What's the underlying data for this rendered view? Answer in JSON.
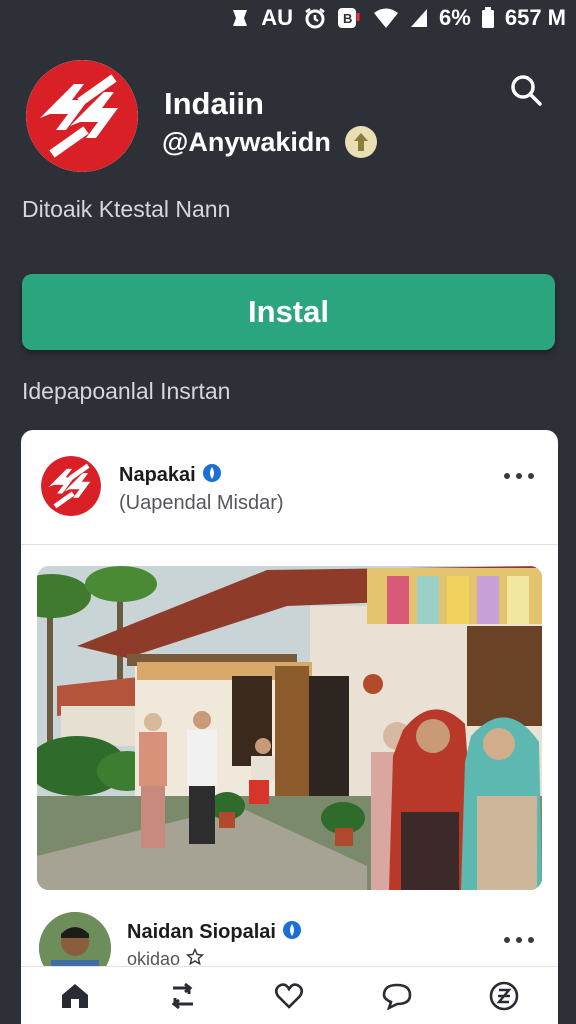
{
  "status_bar": {
    "carrier": "AU",
    "battery_percent": "6%",
    "time": "657 M"
  },
  "profile": {
    "name": "Indaiin",
    "handle": "@Anywakidn",
    "subtitle": "Ditoaik Ktestal Nann",
    "brand_color": "#d92027"
  },
  "install": {
    "label": "Instal",
    "color": "#2aa57d"
  },
  "section": {
    "label": "Idepapoanlal Insrtan"
  },
  "post": {
    "author": "Napakai",
    "subtitle": "(Uapendal Misdar)",
    "image_alt_scene": "village-house-with-people"
  },
  "comment": {
    "author": "Naidan Siopalai",
    "subtitle": "okidao"
  },
  "nav": {
    "items": [
      "home-icon",
      "repost-icon",
      "heart-icon",
      "chat-icon",
      "currency-icon"
    ]
  }
}
